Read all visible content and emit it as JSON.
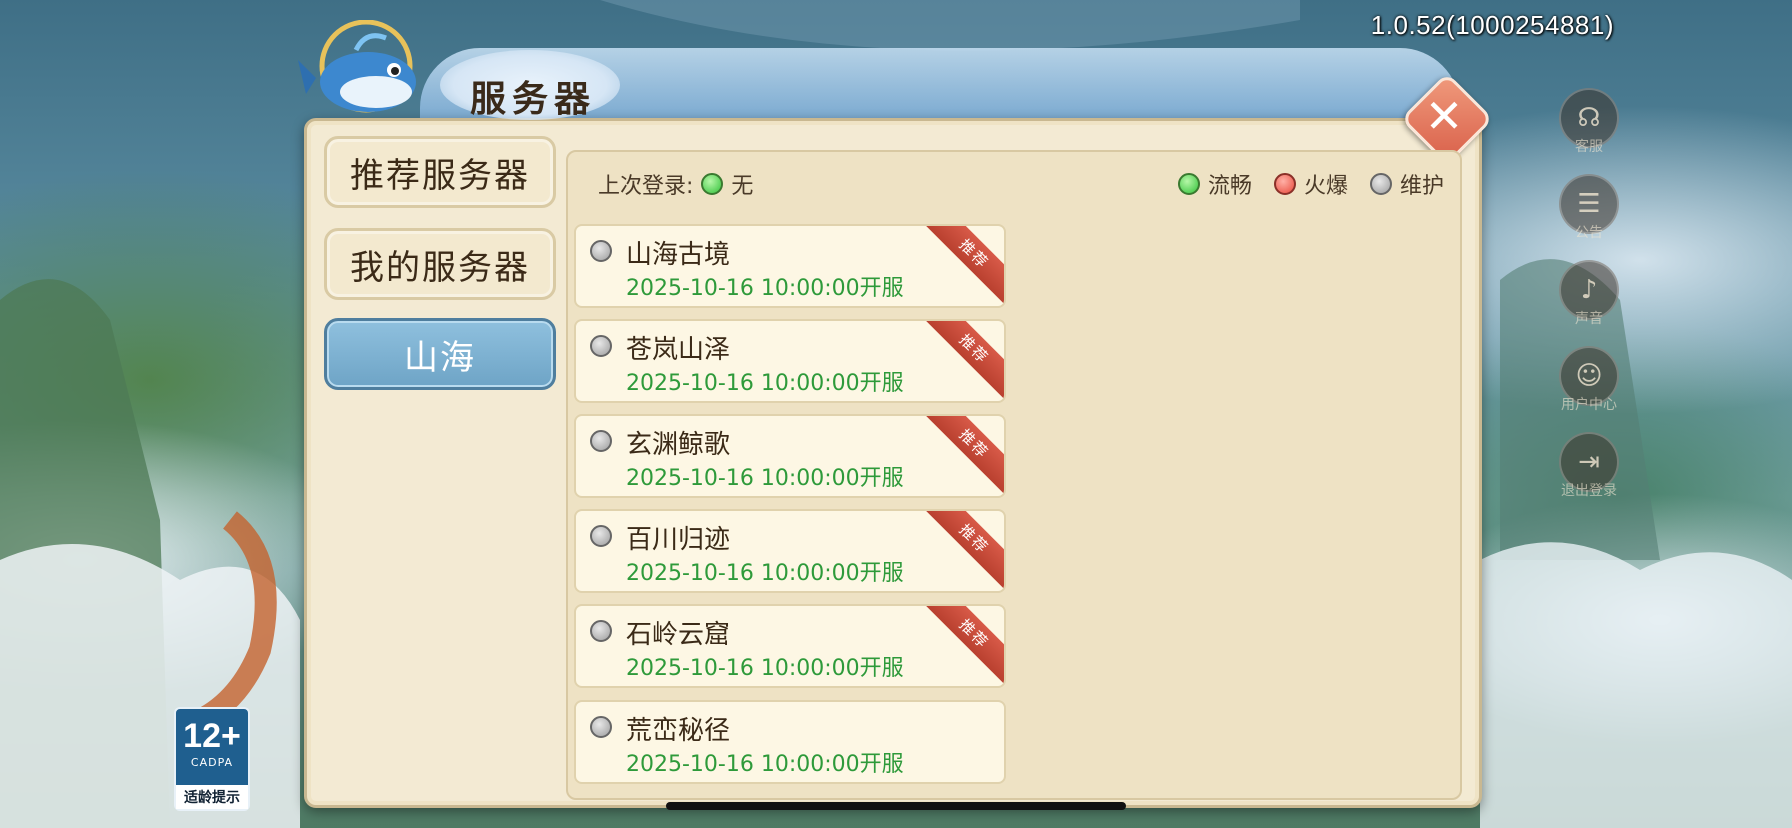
{
  "version": "1.0.52(1000254881)",
  "dialog": {
    "title": "服务器",
    "close_label": "✕"
  },
  "tabs": [
    {
      "label": "推荐服务器",
      "active": false
    },
    {
      "label": "我的服务器",
      "active": false
    },
    {
      "label": "山海",
      "active": true
    }
  ],
  "last_login": {
    "label": "上次登录:",
    "status": "green",
    "value": "无"
  },
  "legend": [
    {
      "label": "流畅",
      "color": "green"
    },
    {
      "label": "火爆",
      "color": "red"
    },
    {
      "label": "维护",
      "color": "gray"
    }
  ],
  "servers": [
    {
      "name": "山海古境",
      "time": "2025-10-16 10:00:00开服",
      "status": "gray",
      "badge": "推荐"
    },
    {
      "name": "苍岚山泽",
      "time": "2025-10-16 10:00:00开服",
      "status": "gray",
      "badge": "推荐"
    },
    {
      "name": "玄渊鲸歌",
      "time": "2025-10-16 10:00:00开服",
      "status": "gray",
      "badge": "推荐"
    },
    {
      "name": "百川归迹",
      "time": "2025-10-16 10:00:00开服",
      "status": "gray",
      "badge": "推荐"
    },
    {
      "name": "石岭云窟",
      "time": "2025-10-16 10:00:00开服",
      "status": "gray",
      "badge": "推荐"
    },
    {
      "name": "荒峦秘径",
      "time": "2025-10-16 10:00:00开服",
      "status": "gray",
      "badge": ""
    }
  ],
  "side_menu": [
    {
      "label": "客服",
      "icon": "headset-icon"
    },
    {
      "label": "公告",
      "icon": "notice-icon"
    },
    {
      "label": "声音",
      "icon": "sound-icon"
    },
    {
      "label": "用户中心",
      "icon": "user-icon"
    },
    {
      "label": "退出登录",
      "icon": "logout-icon"
    }
  ],
  "age_rating": {
    "age": "12+",
    "org": "CADPA",
    "tip": "适龄提示"
  },
  "colors": {
    "online_green": "#2e9a3a",
    "tab_active": "#7fb2d3",
    "badge_red": "#c84a38"
  }
}
